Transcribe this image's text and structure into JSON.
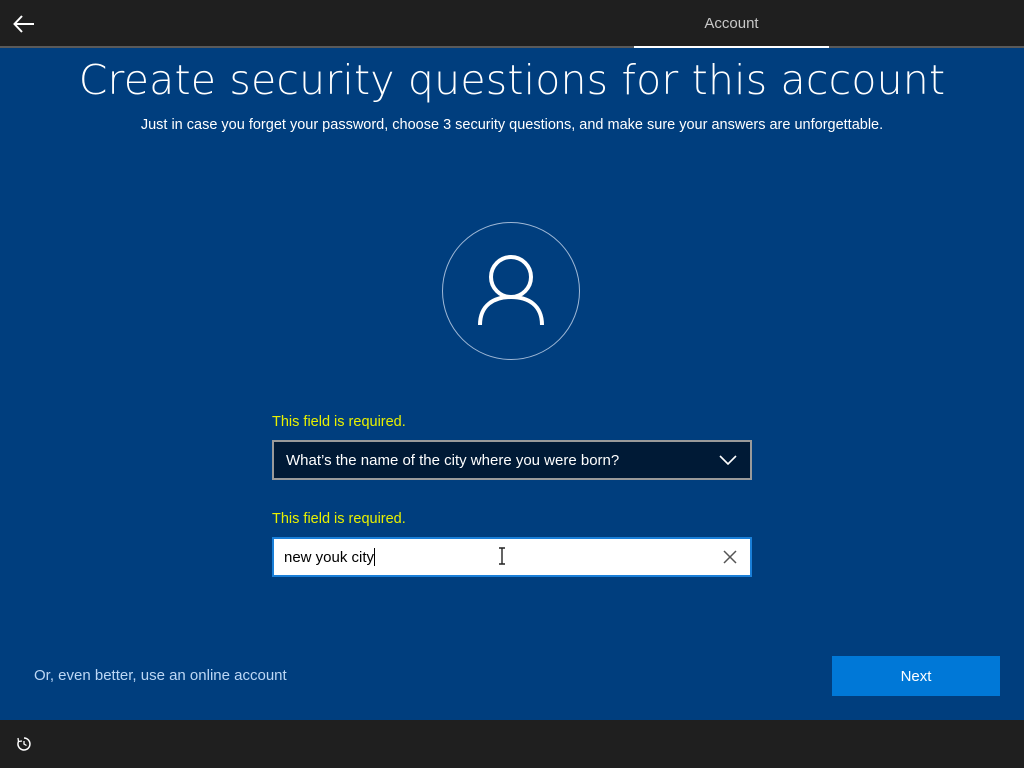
{
  "header": {
    "back_icon": "back-arrow-icon",
    "tab_label": "Account"
  },
  "main": {
    "title": "Create security questions for this account",
    "subtitle": "Just in case you forget your password, choose 3 security questions, and make sure your answers are unforgettable.",
    "avatar_icon": "user-icon",
    "question": {
      "error": "This field is required.",
      "selected": "What’s the name of the city where you were born?",
      "icon": "chevron-down-icon"
    },
    "answer": {
      "error": "This field is required.",
      "value": "new youk city",
      "clear_icon": "close-icon"
    }
  },
  "footer": {
    "online_link": "Or, even better, use an online account",
    "next_label": "Next",
    "ease_icon": "ease-of-access-icon"
  },
  "colors": {
    "background": "#003e7e",
    "error": "#e8f000",
    "accent": "#0078d7",
    "bar": "#1f1f1f"
  }
}
